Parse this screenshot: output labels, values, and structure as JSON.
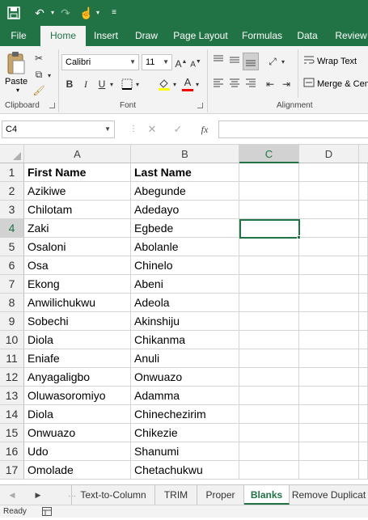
{
  "qat": {
    "save_icon": "save-icon",
    "undo_icon": "undo-icon",
    "redo_icon": "redo-icon",
    "touch_icon": "touch-mode-icon",
    "customize_icon": "customize-qat-icon"
  },
  "tabs": [
    {
      "label": "File"
    },
    {
      "label": "Home"
    },
    {
      "label": "Insert"
    },
    {
      "label": "Draw"
    },
    {
      "label": "Page Layout"
    },
    {
      "label": "Formulas"
    },
    {
      "label": "Data"
    },
    {
      "label": "Review"
    }
  ],
  "ribbon": {
    "clipboard": {
      "paste_label": "Paste",
      "group_label": "Clipboard"
    },
    "font": {
      "name": "Calibri",
      "size": "11",
      "group_label": "Font"
    },
    "alignment": {
      "wrap_label": "Wrap Text",
      "merge_label": "Merge & Cen",
      "group_label": "Alignment"
    }
  },
  "formula_bar": {
    "name_box": "C4",
    "formula": ""
  },
  "grid": {
    "columns": [
      "A",
      "B",
      "C",
      "D"
    ],
    "selected_column": "C",
    "selected_row": 4,
    "rows": [
      {
        "num": "1",
        "a": "First Name",
        "b": "Last Name"
      },
      {
        "num": "2",
        "a": "Azikiwe",
        "b": "Abegunde"
      },
      {
        "num": "3",
        "a": "Chilotam",
        "b": "Adedayo"
      },
      {
        "num": "4",
        "a": "Zaki",
        "b": "Egbede"
      },
      {
        "num": "5",
        "a": "Osaloni",
        "b": "Abolanle"
      },
      {
        "num": "6",
        "a": "Osa",
        "b": "Chinelo"
      },
      {
        "num": "7",
        "a": "Ekong",
        "b": "Abeni"
      },
      {
        "num": "8",
        "a": "Anwilichukwu",
        "b": "Adeola"
      },
      {
        "num": "9",
        "a": "Sobechi",
        "b": "Akinshiju"
      },
      {
        "num": "10",
        "a": "Diola",
        "b": "Chikanma"
      },
      {
        "num": "11",
        "a": "Eniafe",
        "b": "Anuli"
      },
      {
        "num": "12",
        "a": "Anyagaligbo",
        "b": "Onwuazo"
      },
      {
        "num": "13",
        "a": "Oluwasoromiyo",
        "b": "Adamma"
      },
      {
        "num": "14",
        "a": "Diola",
        "b": "Chinechezirim"
      },
      {
        "num": "15",
        "a": "Onwuazo",
        "b": "Chikezie"
      },
      {
        "num": "16",
        "a": "Udo",
        "b": "Shanumi"
      },
      {
        "num": "17",
        "a": "Omolade",
        "b": "Chetachukwu"
      }
    ]
  },
  "sheets": [
    {
      "label": "Text-to-Column"
    },
    {
      "label": "TRIM"
    },
    {
      "label": "Proper"
    },
    {
      "label": "Blanks"
    },
    {
      "label": "Remove Duplicat"
    }
  ],
  "active_sheet": "Blanks",
  "status": {
    "text": "Ready"
  },
  "colors": {
    "accent": "#217346",
    "ribbon_bg": "#f3f3f3",
    "header_bg": "#f1f1f1"
  }
}
